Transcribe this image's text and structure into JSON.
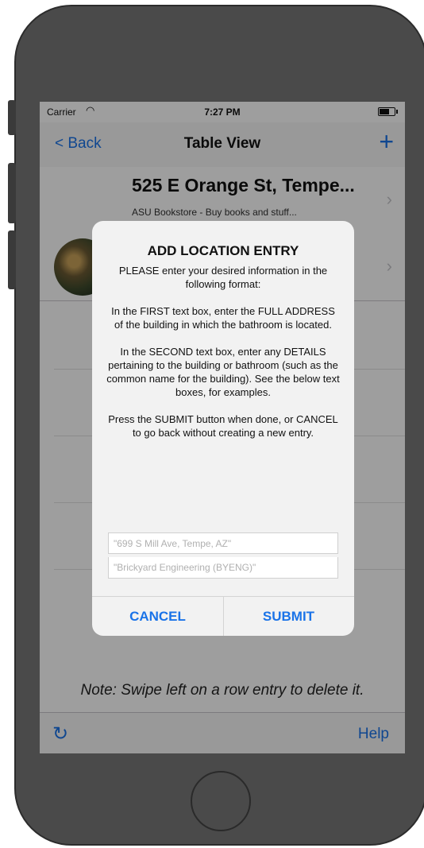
{
  "status": {
    "carrier": "Carrier",
    "time": "7:27 PM"
  },
  "nav": {
    "back_label": "< Back",
    "title": "Table View",
    "add_label": "+"
  },
  "rows": [
    {
      "address": "525 E Orange St, Tempe...",
      "details": "ASU Bookstore - Buy books and stuff..."
    },
    {
      "address": "",
      "details": ""
    }
  ],
  "alert": {
    "title": "ADD LOCATION ENTRY",
    "message": "PLEASE enter your desired information in the following format:\n\nIn the FIRST text box, enter the FULL ADDRESS of the building in which the bathroom is located.\n\nIn the SECOND text box, enter any DETAILS pertaining to the building or bathroom (such as the common name for the building). See the below text boxes, for examples.\n\nPress the SUBMIT button when done, or CANCEL to go back without creating a new entry.",
    "field1_placeholder": "\"699 S Mill Ave, Tempe, AZ\"",
    "field2_placeholder": "\"Brickyard Engineering (BYENG)\"",
    "cancel_label": "CANCEL",
    "submit_label": "SUBMIT"
  },
  "note": "Note: Swipe left on a row entry to delete it.",
  "toolbar": {
    "refresh_icon": "refresh-icon",
    "help_label": "Help"
  },
  "colors": {
    "accent": "#1a73e8",
    "phone_body": "#4a4a4a"
  }
}
